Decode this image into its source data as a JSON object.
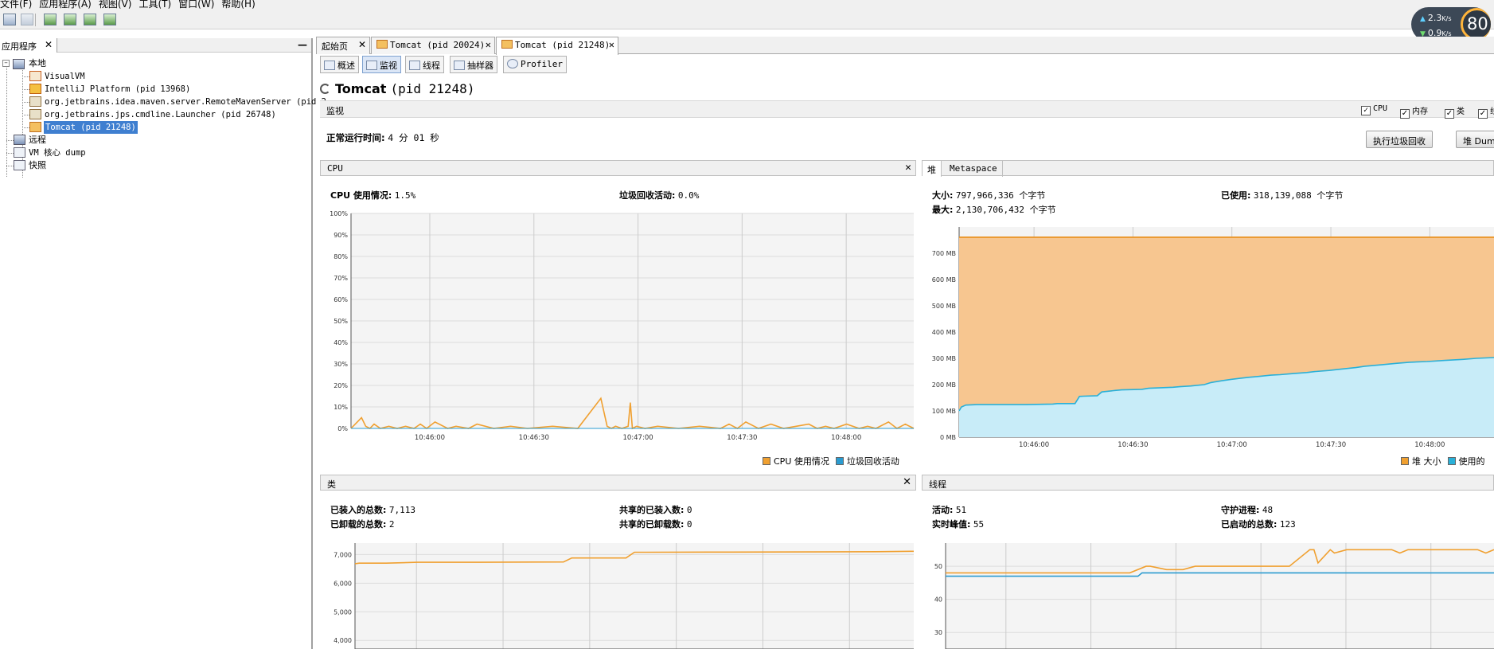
{
  "menubar": [
    "文件(F)",
    "应用程序(A)",
    "视图(V)",
    "工具(T)",
    "窗口(W)",
    "帮助(H)"
  ],
  "net_widget": {
    "upload": "2.3",
    "upload_unit": "K/s",
    "download": "0.9",
    "download_unit": "K/s",
    "gauge": "80"
  },
  "left_panel": {
    "tab_label": "应用程序",
    "tree": {
      "local": "本地",
      "visualvm": "VisualVM",
      "intellij": "IntelliJ Platform (pid 13968)",
      "maven": "org.jetbrains.idea.maven.server.RemoteMavenServer (pid 2",
      "launcher": "org.jetbrains.jps.cmdline.Launcher (pid 26748)",
      "tomcat": "Tomcat (pid 21248)",
      "remote": "远程",
      "vmcore": "VM 核心 dump",
      "snapshot": "快照"
    }
  },
  "doc_tabs": [
    "起始页",
    "Tomcat (pid 20024)",
    "Tomcat (pid 21248)"
  ],
  "sub_tabs": [
    "概述",
    "监视",
    "线程",
    "抽样器",
    "Profiler"
  ],
  "page_title": {
    "name": "Tomcat",
    "pid": "(pid 21248)"
  },
  "monitor": {
    "label": "监视",
    "checkboxes": [
      "CPU",
      "内存",
      "类",
      "线"
    ],
    "uptime_label": "正常运行时间:",
    "uptime_value": "4 分 01 秒",
    "gc_button": "执行垃圾回收",
    "heapdump_button": "堆 Dump"
  },
  "cpu_panel": {
    "title": "CPU",
    "cpu_label": "CPU 使用情况:",
    "cpu_value": "1.5%",
    "gc_label": "垃圾回收活动:",
    "gc_value": "0.0%",
    "legend": [
      "CPU 使用情况",
      "垃圾回收活动"
    ]
  },
  "heap_panel": {
    "tabs": [
      "堆",
      "Metaspace"
    ],
    "size_label": "大小:",
    "size_value": "797,966,336 个字节",
    "used_label": "已使用:",
    "used_value": "318,139,088 个字节",
    "max_label": "最大:",
    "max_value": "2,130,706,432 个字节",
    "legend": [
      "堆 大小",
      "使用的"
    ]
  },
  "classes_panel": {
    "title": "类",
    "loaded_label": "已装入的总数:",
    "loaded_value": "7,113",
    "unloaded_label": "已卸载的总数:",
    "unloaded_value": "2",
    "shared_loaded_label": "共享的已装入数:",
    "shared_loaded_value": "0",
    "shared_unloaded_label": "共享的已卸载数:",
    "shared_unloaded_value": "0"
  },
  "threads_panel": {
    "title": "线程",
    "live_label": "活动:",
    "live_value": "51",
    "daemon_label": "守护进程:",
    "daemon_value": "48",
    "peak_label": "实时峰值:",
    "peak_value": "55",
    "started_label": "已启动的总数:",
    "started_value": "123"
  },
  "chart_data": [
    {
      "type": "line",
      "name": "cpu",
      "x_ticks": [
        "10:46:00",
        "10:46:30",
        "10:47:00",
        "10:47:30",
        "10:48:00"
      ],
      "y_ticks": [
        "100%",
        "90%",
        "80%",
        "70%",
        "60%",
        "50%",
        "40%",
        "30%",
        "20%",
        "10%",
        "0%"
      ],
      "ylim": [
        0,
        100
      ],
      "x_range_seconds": [
        0,
        268
      ],
      "series": [
        {
          "name": "CPU 使用情况",
          "color": "#f0a030",
          "x": [
            0,
            3,
            5,
            7,
            9,
            11,
            14,
            18,
            22,
            26,
            30,
            33,
            36,
            40,
            46,
            50,
            56,
            60,
            68,
            76,
            84,
            96,
            108,
            119,
            122,
            124,
            126,
            129,
            132,
            133,
            134,
            136,
            140,
            146,
            156,
            166,
            176,
            180,
            184,
            188,
            194,
            200,
            206,
            212,
            218,
            222,
            226,
            230,
            236,
            242,
            246,
            250,
            256,
            260,
            264,
            268
          ],
          "y": [
            0,
            3,
            5,
            1,
            0,
            2,
            0,
            1,
            0,
            1,
            0,
            2,
            0,
            3,
            0,
            1,
            0,
            2,
            0,
            1,
            0,
            1,
            0,
            14,
            1,
            0,
            1,
            0,
            1,
            12,
            0,
            1,
            0,
            1,
            0,
            1,
            0,
            2,
            0,
            3,
            0,
            2,
            0,
            1,
            2,
            0,
            1,
            0,
            2,
            0,
            1,
            0,
            3,
            0,
            2,
            0
          ]
        },
        {
          "name": "垃圾回收活动",
          "color": "#2a9bd0",
          "x": [
            0,
            268
          ],
          "y": [
            0,
            0
          ]
        }
      ]
    },
    {
      "type": "area",
      "name": "heap",
      "x_ticks": [
        "10:46:00",
        "10:46:30",
        "10:47:00",
        "10:47:30",
        "10:48:00"
      ],
      "y_ticks": [
        "700 MB",
        "600 MB",
        "500 MB",
        "400 MB",
        "300 MB",
        "200 MB",
        "100 MB",
        "0 MB"
      ],
      "ylim": [
        0,
        800
      ],
      "x_range_seconds": [
        0,
        240
      ],
      "series": [
        {
          "name": "堆 大小",
          "color": "#f0a030",
          "x": [
            0,
            240
          ],
          "y": [
            761,
            761
          ]
        },
        {
          "name": "使用的",
          "color": "#2ab0d8",
          "x": [
            0,
            1,
            3,
            8,
            30,
            42,
            44,
            52,
            54,
            56,
            62,
            64,
            70,
            73,
            82,
            85,
            96,
            99,
            104,
            110,
            113,
            118,
            122,
            126,
            130,
            134,
            140,
            144,
            150,
            156,
            160,
            166,
            170,
            178,
            182,
            190,
            196,
            202,
            210,
            218,
            226,
            232,
            240
          ],
          "y": [
            100,
            115,
            122,
            124,
            124,
            126,
            128,
            128,
            155,
            156,
            158,
            172,
            178,
            180,
            182,
            186,
            190,
            192,
            195,
            200,
            208,
            215,
            220,
            224,
            228,
            231,
            236,
            238,
            242,
            246,
            250,
            254,
            258,
            265,
            270,
            276,
            281,
            285,
            288,
            292,
            296,
            300,
            303
          ]
        }
      ]
    },
    {
      "type": "line",
      "name": "classes",
      "y_ticks": [
        "7,000",
        "6,000",
        "5,000",
        "4,000"
      ],
      "ylim": [
        3700,
        7400
      ],
      "x_range_seconds": [
        0,
        268
      ],
      "series": [
        {
          "name": "classes-loaded",
          "color": "#f0a030",
          "x": [
            0,
            2,
            15,
            30,
            60,
            100,
            104,
            130,
            134,
            140,
            180,
            220,
            250,
            268
          ],
          "y": [
            6680,
            6700,
            6700,
            6730,
            6730,
            6740,
            6880,
            6880,
            7080,
            7080,
            7085,
            7090,
            7100,
            7113
          ]
        }
      ]
    },
    {
      "type": "line",
      "name": "threads",
      "y_ticks": [
        "50",
        "40",
        "30"
      ],
      "ylim": [
        25,
        57
      ],
      "x_range_seconds": [
        0,
        268
      ],
      "series": [
        {
          "name": "threads-live",
          "color": "#f0a030",
          "x": [
            0,
            30,
            90,
            98,
            100,
            108,
            116,
            122,
            136,
            150,
            168,
            178,
            180,
            182,
            188,
            190,
            196,
            200,
            204,
            218,
            222,
            226,
            260,
            264,
            268
          ],
          "y": [
            48,
            48,
            48,
            50,
            50,
            49,
            49,
            50,
            50,
            50,
            50,
            55,
            55,
            51,
            55,
            54,
            55,
            55,
            55,
            55,
            54,
            55,
            55,
            54,
            55
          ]
        },
        {
          "name": "threads-daemon",
          "color": "#2a9bd0",
          "x": [
            0,
            94,
            96,
            268
          ],
          "y": [
            47,
            47,
            48,
            48
          ]
        }
      ]
    }
  ]
}
